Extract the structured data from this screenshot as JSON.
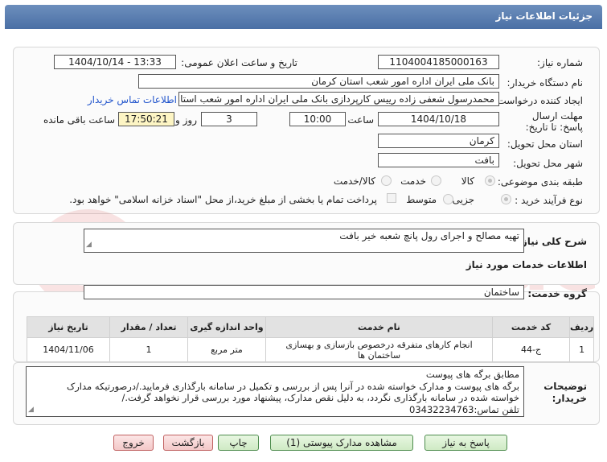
{
  "header": {
    "title": "جزئیات اطلاعات نیاز"
  },
  "watermark": {
    "text": "AriaTender.net",
    "color": "#d9534f"
  },
  "form": {
    "need_number_label": "شماره نیاز:",
    "need_number": "1104004185000163",
    "announce_label": "تاریخ و ساعت اعلان عمومی:",
    "announce_value": "1404/10/14 - 13:33",
    "buyer_label": "نام دستگاه خریدار:",
    "buyer_value": "بانک ملی ایران اداره امور شعب استان کرمان",
    "creator_label": "ایجاد کننده درخواست:",
    "creator_value": "محمدرسول شعفی زاده رییس کارپردازی بانک ملی ایران اداره امور شعب استان",
    "contact_link": "اطلاعات تماس خریدار",
    "deadline_label": "مهلت ارسال پاسخ: تا تاریخ:",
    "deadline_date": "1404/10/18",
    "time_label": "ساعت",
    "deadline_time": "10:00",
    "days_value": "3",
    "days_label": "روز و",
    "remaining_time": "17:50:21",
    "remaining_label": "ساعت باقی مانده",
    "province_label": "استان محل تحویل:",
    "province_value": "کرمان",
    "city_label": "شهر محل تحویل:",
    "city_value": "بافت",
    "category_label": "طبقه بندی موضوعی:",
    "category_options": [
      "کالا",
      "خدمت",
      "کالا/خدمت"
    ],
    "purchase_label": "نوع فرآیند خرید :",
    "purchase_options": [
      "جزیی",
      "متوسط"
    ],
    "payment_note": "پرداخت تمام یا بخشی از مبلغ خرید،از محل \"اسناد خزانه اسلامی\" خواهد بود."
  },
  "description": {
    "label": "شرح کلی نیاز:",
    "value": "تهیه مصالح و اجرای رول پانچ شعبه خیر بافت"
  },
  "services": {
    "title": "اطلاعات خدمات مورد نیاز",
    "group_label": "گروه خدمت:",
    "group_value": "ساختمان",
    "columns": [
      "ردیف",
      "کد خدمت",
      "نام خدمت",
      "واحد اندازه گیری",
      "تعداد / مقدار",
      "تاریخ نیاز"
    ],
    "rows": [
      {
        "row": "1",
        "code": "ج-44",
        "name": "انجام کارهای متفرقه درخصوص بازسازی و بهسازی ساختمان ها",
        "unit": "متر مربع",
        "qty": "1",
        "date": "1404/11/06"
      }
    ]
  },
  "notes": {
    "label": "توضیحات خریدار:",
    "lines": [
      "مطابق برگه های پیوست",
      "برگه های پیوست و مدارک خواسته شده در آنرا پس از بررسی و تکمیل در سامانه بارگذاری فرمایید./درصورتیکه مدارک",
      "خواسته شده در سامانه بارگذاری نگردد، به دلیل نقص مدارک، پیشنهاد مورد بررسی قرار نخواهد گرفت./",
      "تلفن تماس:03432234763"
    ]
  },
  "buttons": {
    "respond": "پاسخ به نیاز",
    "view_docs": "مشاهده مدارک پیوستی (1)",
    "print": "چاپ",
    "back": "بازگشت",
    "exit": "خروج"
  }
}
